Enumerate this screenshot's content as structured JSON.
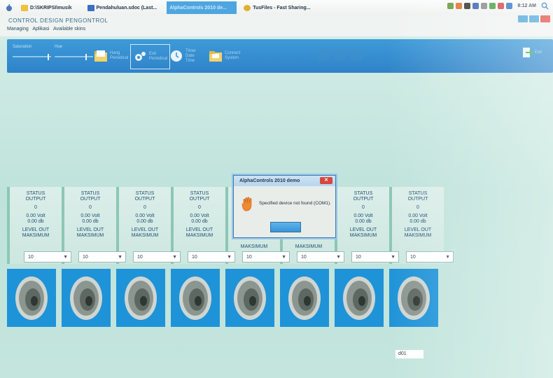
{
  "taskbar": {
    "items": [
      {
        "label": "D:\\SKRIPSI\\musik"
      },
      {
        "label": "Pendahuluan.sdoc (Last..."
      },
      {
        "label": "AlphaControls 2010 de..."
      },
      {
        "label": "TusFiles - Fast Sharing..."
      }
    ],
    "clock": "8:12 AM"
  },
  "app": {
    "title": "CONTROL DESIGN PENGONTROL",
    "menu": [
      "Managing",
      "Aplikasi",
      "Available skins"
    ]
  },
  "ribbon": {
    "sliders": [
      {
        "label": "Saturation",
        "value_label": "0"
      },
      {
        "label": "Hue",
        "value_label": "0"
      }
    ],
    "buttons": [
      {
        "label": "Hang\nPeriodical"
      },
      {
        "label": "Exit\nPeriodical"
      },
      {
        "label": "Timer\nDate Time"
      },
      {
        "label": "Connect\nSystem"
      }
    ],
    "exit_label": "Exit"
  },
  "panels": [
    {
      "status": "STATUS",
      "output": "OUTPUT",
      "value": "0",
      "volt": "0.00 Volt",
      "db": "0.00 db",
      "level": "LEVEL OUT",
      "max": "MAKSIMUM",
      "select": "10"
    },
    {
      "status": "STATUS",
      "output": "OUTPUT",
      "value": "0",
      "volt": "0.00 Volt",
      "db": "0.00 db",
      "level": "LEVEL OUT",
      "max": "MAKSIMUM",
      "select": "10"
    },
    {
      "status": "STATUS",
      "output": "OUTPUT",
      "value": "0",
      "volt": "0.00 Volt",
      "db": "0.00 db",
      "level": "LEVEL OUT",
      "max": "MAKSIMUM",
      "select": "10"
    },
    {
      "status": "STATUS",
      "output": "OUTPUT",
      "value": "0",
      "volt": "0.00 Volt",
      "db": "0.00 db",
      "level": "LEVEL OUT",
      "max": "MAKSIMUM",
      "select": "10"
    },
    {
      "status": "",
      "output": "",
      "value": "",
      "volt": "",
      "db": "",
      "level": "",
      "max": "MAKSIMUM",
      "select": "10"
    },
    {
      "status": "",
      "output": "",
      "value": "",
      "volt": "",
      "db": "",
      "level": "",
      "max": "MAKSIMUM",
      "select": "10"
    },
    {
      "status": "STATUS",
      "output": "OUTPUT",
      "value": "0",
      "volt": "0.00 Volt",
      "db": "0.00 db",
      "level": "LEVEL OUT",
      "max": "MAKSIMUM",
      "select": "10"
    },
    {
      "status": "STATUS",
      "output": "OUTPUT",
      "value": "0",
      "volt": "0.00 Volt",
      "db": "0.00 db",
      "level": "LEVEL OUT",
      "max": "MAKSIMUM",
      "select": "10"
    }
  ],
  "dialog": {
    "title": "AlphaControls 2010 demo",
    "message": "Specified device not found (COM1)."
  },
  "bottom_field": "d01",
  "colors": {
    "ribbon": "#2f83c8",
    "speaker_bg": "#1f93d8",
    "app_bg": "#c3e5dd",
    "close": "#d9473c"
  }
}
